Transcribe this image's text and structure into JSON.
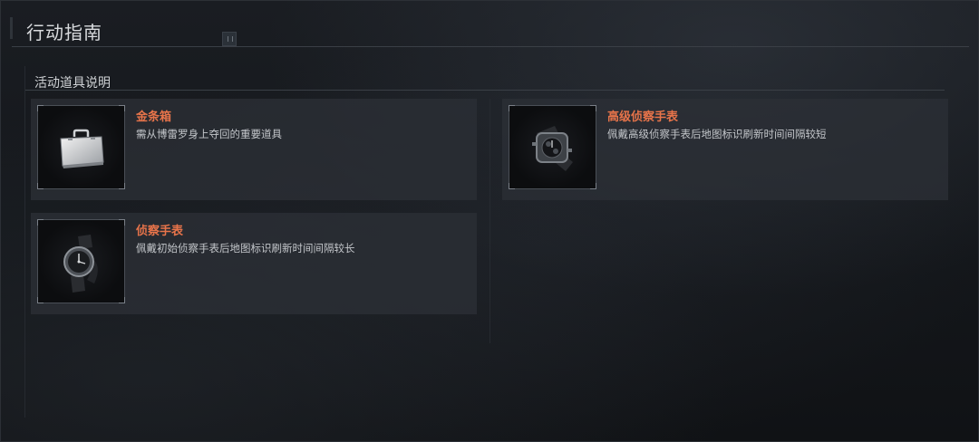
{
  "header": {
    "title": "行动指南"
  },
  "section": {
    "title": "活动道具说明"
  },
  "items": [
    {
      "name": "金条箱",
      "description": "需从博雷罗身上夺回的重要道具",
      "icon": "briefcase-icon"
    },
    {
      "name": "侦察手表",
      "description": "佩戴初始侦察手表后地图标识刷新时间间隔较长",
      "icon": "watch-icon"
    },
    {
      "name": "高级侦察手表",
      "description": "佩戴高级侦察手表后地图标识刷新时间间隔较短",
      "icon": "advanced-watch-icon"
    }
  ],
  "colors": {
    "accent": "#e8744a",
    "card_bg": "#2c3036",
    "background": "#14171b"
  }
}
